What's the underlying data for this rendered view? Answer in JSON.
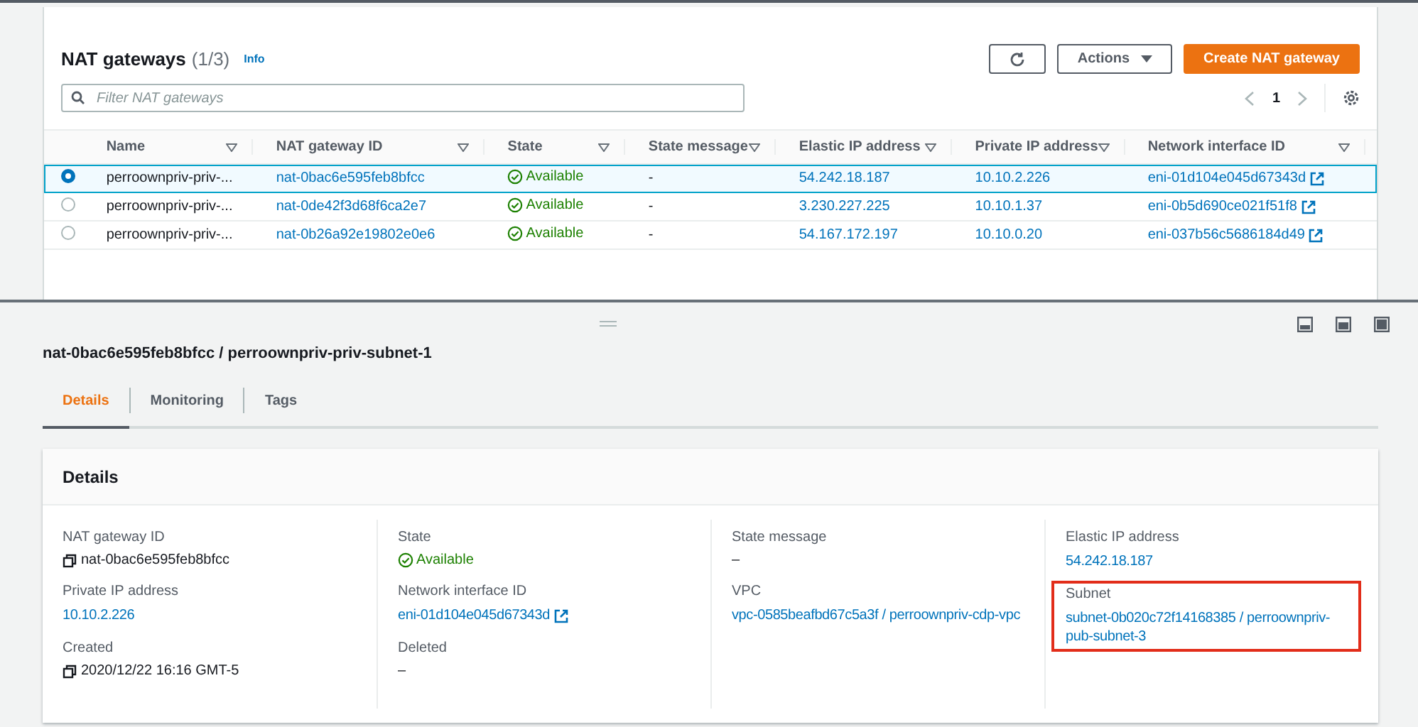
{
  "list": {
    "title": "NAT gateways",
    "count": "(1/3)",
    "info": "Info",
    "buttons": [
      {
        "kind": "refresh"
      },
      {
        "kind": "dropdown",
        "label": "Actions"
      },
      {
        "kind": "primary",
        "label": "Create NAT gateway"
      }
    ],
    "search": {
      "placeholder": "Filter NAT gateways"
    },
    "pagination": {
      "page": "1"
    },
    "columns": [
      "Name",
      "NAT gateway ID",
      "State",
      "State message",
      "Elastic IP address",
      "Private IP address",
      "Network interface ID"
    ],
    "rows": [
      {
        "selected": true,
        "name": "perroownpriv-priv-...",
        "id": "nat-0bac6e595feb8bfcc",
        "state": "Available",
        "message": "-",
        "elastic_ip": "54.242.18.187",
        "private_ip": "10.10.2.226",
        "eni": "eni-01d104e045d67343d"
      },
      {
        "selected": false,
        "name": "perroownpriv-priv-...",
        "id": "nat-0de42f3d68f6ca2e7",
        "state": "Available",
        "message": "-",
        "elastic_ip": "3.230.227.225",
        "private_ip": "10.10.1.37",
        "eni": "eni-0b5d690ce021f51f8"
      },
      {
        "selected": false,
        "name": "perroownpriv-priv-...",
        "id": "nat-0b26a92e19802e0e6",
        "state": "Available",
        "message": "-",
        "elastic_ip": "54.167.172.197",
        "private_ip": "10.10.0.20",
        "eni": "eni-037b56c5686184d49"
      }
    ]
  },
  "detail": {
    "title": "nat-0bac6e595feb8bfcc / perroownpriv-priv-subnet-1",
    "tabs": [
      {
        "label": "Details",
        "selected": true
      },
      {
        "label": "Monitoring",
        "selected": false
      },
      {
        "label": "Tags",
        "selected": false
      }
    ],
    "card_title": "Details",
    "columns": [
      [
        {
          "label": "NAT gateway ID",
          "kind": "copy",
          "value": "nat-0bac6e595feb8bfcc",
          "highlighted": false
        },
        {
          "label": "Private IP address",
          "kind": "link",
          "value": "10.10.2.226",
          "highlighted": false
        },
        {
          "label": "Created",
          "kind": "copy",
          "value": "2020/12/22 16:16 GMT-5",
          "highlighted": false
        }
      ],
      [
        {
          "label": "State",
          "kind": "status",
          "value": "Available",
          "highlighted": false
        },
        {
          "label": "Network interface ID",
          "kind": "external",
          "value": "eni-01d104e045d67343d",
          "highlighted": false
        },
        {
          "label": "Deleted",
          "kind": "text",
          "value": "–",
          "highlighted": false
        }
      ],
      [
        {
          "label": "State message",
          "kind": "text",
          "value": "–",
          "highlighted": false
        },
        {
          "label": "VPC",
          "kind": "link",
          "value": "vpc-0585beafbd67c5a3f / perroownpriv-cdp-vpc",
          "highlighted": false
        }
      ],
      [
        {
          "label": "Elastic IP address",
          "kind": "link",
          "value": "54.242.18.187",
          "highlighted": false
        },
        {
          "label": "Subnet",
          "kind": "link",
          "value": "subnet-0b020c72f14168385 / perroownpriv-pub-subnet-3",
          "highlighted": true
        }
      ]
    ]
  }
}
